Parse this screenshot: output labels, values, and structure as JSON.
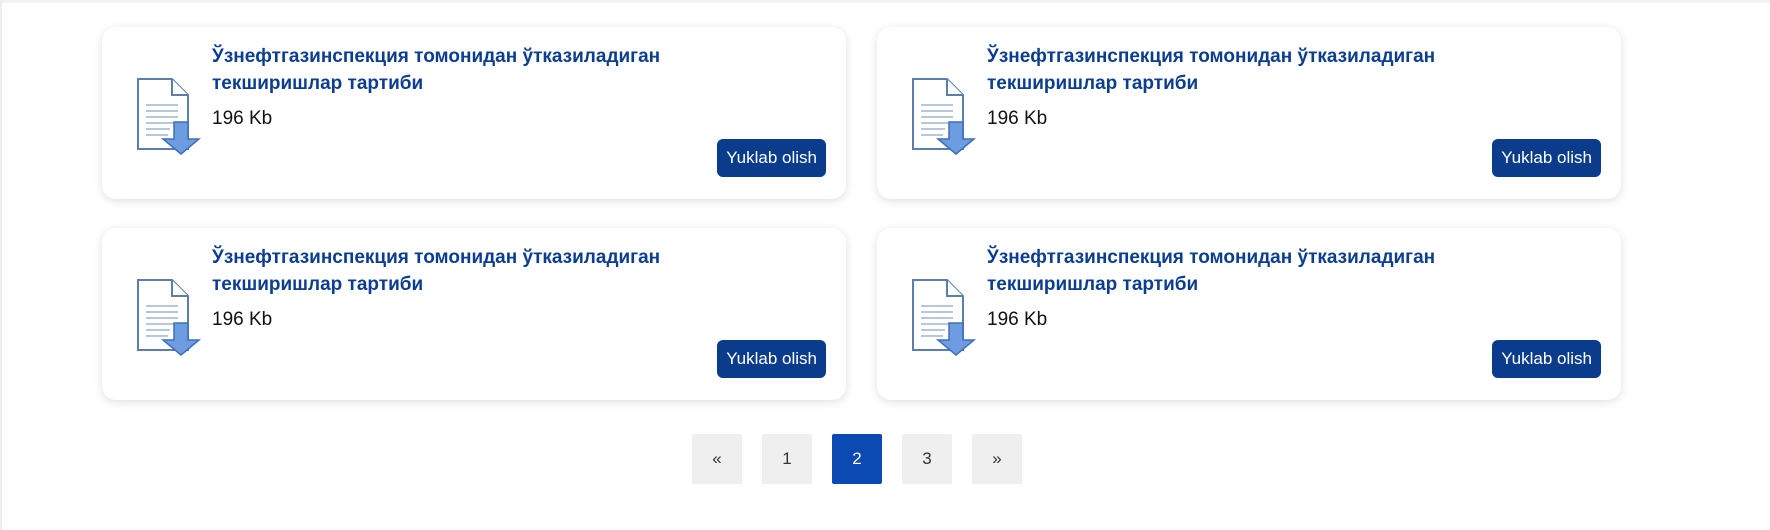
{
  "documents": [
    {
      "title": "Ўзнефтгазинспекция томонидан ўтказиладиган текширишлар тартиби",
      "size": "196 Kb",
      "button_label": "Yuklab olish",
      "icon": "document-download-icon"
    },
    {
      "title": "Ўзнефтгазинспекция томонидан ўтказиладиган текширишлар тартиби",
      "size": "196 Kb",
      "button_label": "Yuklab olish",
      "icon": "document-download-icon"
    },
    {
      "title": "Ўзнефтгазинспекция томонидан ўтказиладиган текширишлар тартиби",
      "size": "196 Kb",
      "button_label": "Yuklab olish",
      "icon": "document-download-icon"
    },
    {
      "title": "Ўзнефтгазинспекция томонидан ўтказиладиган текширишлар тартиби",
      "size": "196 Kb",
      "button_label": "Yuklab olish",
      "icon": "document-download-icon"
    }
  ],
  "pagination": {
    "prev_label": "«",
    "pages": [
      "1",
      "2",
      "3"
    ],
    "current_page": "2",
    "next_label": "»"
  },
  "colors": {
    "title": "#0c3e8f",
    "button_bg": "#0b3c8c",
    "active_page_bg": "#0b49b3",
    "page_bg": "#efefef",
    "icon_outline": "#5b7fa8",
    "icon_arrow": "#6d9de0"
  }
}
